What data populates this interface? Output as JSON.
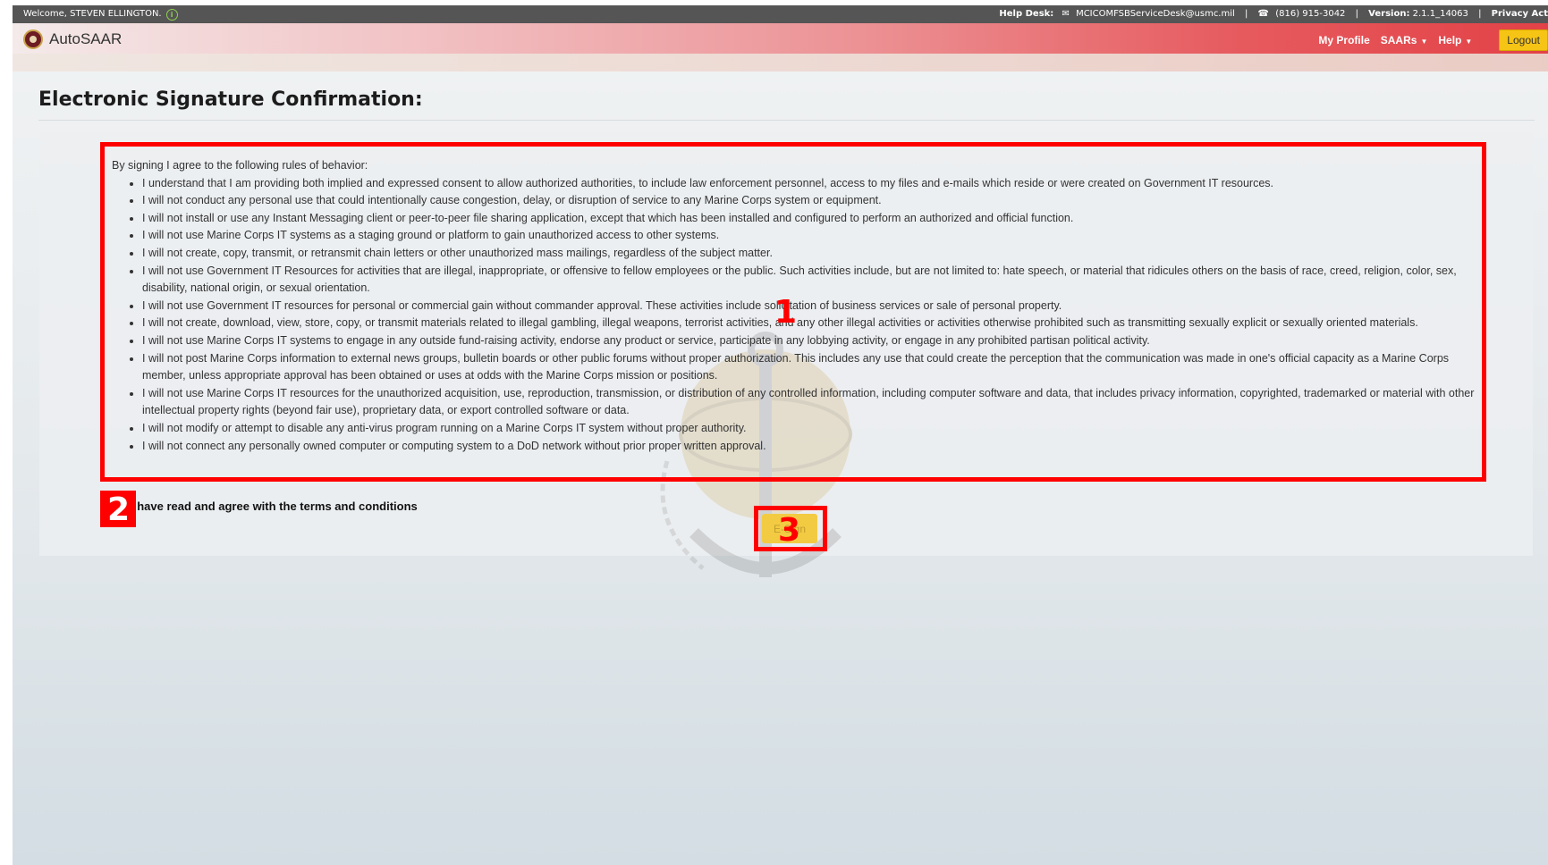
{
  "topbar": {
    "welcome": "Welcome, STEVEN ELLINGTON.",
    "help_desk_label": "Help Desk:",
    "help_desk_email": "MCICOMFSBServiceDesk@usmc.mil",
    "phone": "(816) 915-3042",
    "version_label": "Version:",
    "version": "2.1.1_14063",
    "privacy": "Privacy Act"
  },
  "navbar": {
    "brand": "AutoSAAR",
    "my_profile": "My Profile",
    "saars": "SAARs",
    "help": "Help",
    "logout": "Logout"
  },
  "page": {
    "title": "Electronic Signature Confirmation:"
  },
  "terms": {
    "intro": "By signing I agree to the following rules of behavior:",
    "rules": [
      "I understand that I am providing both implied and expressed consent to allow authorized authorities, to include law enforcement personnel, access to my files and e-mails which reside or were created on Government IT resources.",
      "I will not conduct any personal use that could intentionally cause congestion, delay, or disruption of service to any Marine Corps system or equipment.",
      "I will not install or use any Instant Messaging client or peer-to-peer file sharing application, except that which has been installed and configured to perform an authorized and official function.",
      "I will not use Marine Corps IT systems as a staging ground or platform to gain unauthorized access to other systems.",
      "I will not create, copy, transmit, or retransmit chain letters or other unauthorized mass mailings, regardless of the subject matter.",
      "I will not use Government IT Resources for activities that are illegal, inappropriate, or offensive to fellow employees or the public. Such activities include, but are not limited to: hate speech, or material that ridicules others on the basis of race, creed, religion, color, sex, disability, national origin, or sexual orientation.",
      "I will not use Government IT resources for personal or commercial gain without commander approval. These activities include solicitation of business services or sale of personal property.",
      "I will not create, download, view, store, copy, or transmit materials related to illegal gambling, illegal weapons, terrorist activities, and any other illegal activities or activities otherwise prohibited such as transmitting sexually explicit or sexually oriented materials.",
      "I will not use Marine Corps IT systems to engage in any outside fund-raising activity, endorse any product or service, participate in any lobbying activity, or engage in any prohibited partisan political activity.",
      "I will not post Marine Corps information to external news groups, bulletin boards or other public forums without proper authorization. This includes any use that could create the perception that the communication was made in one's official capacity as a Marine Corps member, unless appropriate approval has been obtained or uses at odds with the Marine Corps mission or positions.",
      "I will not use Marine Corps IT resources for the unauthorized acquisition, use, reproduction, transmission, or distribution of any controlled information, including computer software and data, that includes privacy information, copyrighted, trademarked or material with other intellectual property rights (beyond fair use), proprietary data, or export controlled software or data.",
      "I will not modify or attempt to disable any anti-virus program running on a Marine Corps IT system without proper authority.",
      "I will not connect any personally owned computer or computing system to a DoD network without prior proper written approval."
    ]
  },
  "agree": {
    "label": "I have read and agree with the terms and conditions",
    "checked": false
  },
  "esign_button": "E-Sign",
  "markers": [
    "1",
    "2",
    "3"
  ],
  "colors": {
    "marker": "#ff0000",
    "logout_bg": "#f6c414",
    "esign_bg": "#f2cb43",
    "topbar_bg": "#555555",
    "navbar_accent": "#e24247"
  }
}
